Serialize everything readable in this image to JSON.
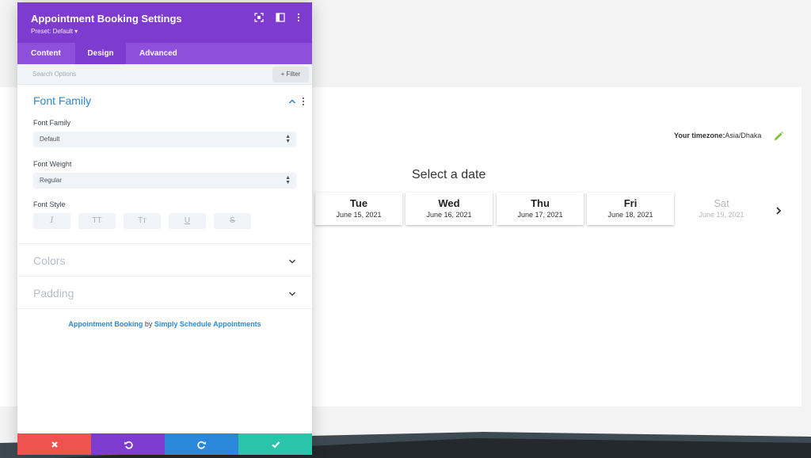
{
  "panel": {
    "title": "Appointment Booking Settings",
    "preset": "Preset: Default ▾",
    "tabs": [
      {
        "label": "Content"
      },
      {
        "label": "Design"
      },
      {
        "label": "Advanced"
      }
    ],
    "search_placeholder": "Search Options",
    "filter_label": "+ Filter",
    "font_section": {
      "title": "Font Family",
      "family_label": "Font Family",
      "family_value": "Default",
      "weight_label": "Font Weight",
      "weight_value": "Regular",
      "style_label": "Font Style",
      "style_buttons": [
        "I",
        "TT",
        "Tт",
        "U",
        "S"
      ]
    },
    "colors_title": "Colors",
    "padding_title": "Padding",
    "credit": {
      "link1": "Appointment Booking",
      "by": " by ",
      "link2": "Simply Schedule Appointments"
    }
  },
  "booking": {
    "timezone_label": "Your timezone:",
    "timezone_value": "Asia/Dhaka",
    "select_title": "Select a date",
    "days": [
      {
        "name": "Tue",
        "date": "June 15, 2021",
        "available": true
      },
      {
        "name": "Wed",
        "date": "June 16, 2021",
        "available": true
      },
      {
        "name": "Thu",
        "date": "June 17, 2021",
        "available": true
      },
      {
        "name": "Fri",
        "date": "June 18, 2021",
        "available": true
      },
      {
        "name": "Sat",
        "date": "June 19, 2021",
        "available": false
      }
    ]
  },
  "colors": {
    "header": "#7e3bd0",
    "tabs": "#8e4fdb",
    "section_title_active": "#2c89d1",
    "section_title_inactive": "#b6bcc6",
    "cancel": "#ef5350",
    "undo": "#7e3bd0",
    "redo": "#2b87da",
    "save": "#29c4a9",
    "edit_icon": "#7cc43b"
  }
}
